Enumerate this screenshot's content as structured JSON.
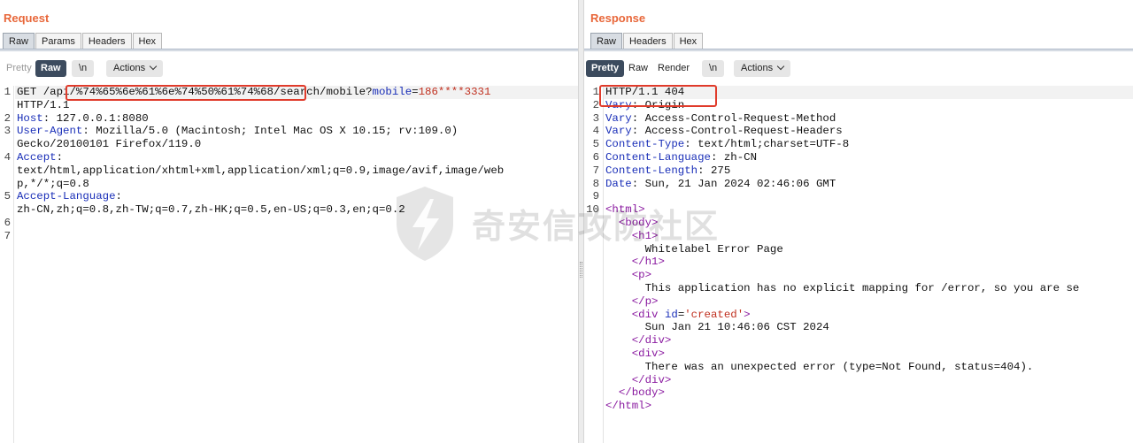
{
  "request": {
    "title": "Request",
    "tabs": [
      "Raw",
      "Params",
      "Headers",
      "Hex"
    ],
    "active_tab": "Raw",
    "toolbar": {
      "pretty": "Pretty",
      "raw": "Raw",
      "newline": "\\n",
      "actions": "Actions"
    },
    "lines": [
      {
        "n": "1",
        "parts": [
          [
            "t",
            "GET /api/%74%65%6e%61%6e%74%50%61%74%68/search/mobile?"
          ],
          [
            "k",
            "mobile"
          ],
          [
            "t",
            "="
          ],
          [
            "v",
            "186****3331"
          ]
        ]
      },
      {
        "n": "",
        "parts": [
          [
            "t",
            "HTTP/1.1"
          ]
        ]
      },
      {
        "n": "2",
        "parts": [
          [
            "k",
            "Host"
          ],
          [
            "t",
            ": 127.0.0.1:8080"
          ]
        ]
      },
      {
        "n": "3",
        "parts": [
          [
            "k",
            "User-Agent"
          ],
          [
            "t",
            ": Mozilla/5.0 (Macintosh; Intel Mac OS X 10.15; rv:109.0)"
          ]
        ]
      },
      {
        "n": "",
        "parts": [
          [
            "t",
            "Gecko/20100101 Firefox/119.0"
          ]
        ]
      },
      {
        "n": "4",
        "parts": [
          [
            "k",
            "Accept"
          ],
          [
            "t",
            ":"
          ]
        ]
      },
      {
        "n": "",
        "parts": [
          [
            "t",
            "text/html,application/xhtml+xml,application/xml;q=0.9,image/avif,image/web"
          ]
        ]
      },
      {
        "n": "",
        "parts": [
          [
            "t",
            "p,*/*;q=0.8"
          ]
        ]
      },
      {
        "n": "5",
        "parts": [
          [
            "k",
            "Accept-Language"
          ],
          [
            "t",
            ":"
          ]
        ]
      },
      {
        "n": "",
        "parts": [
          [
            "t",
            "zh-CN,zh;q=0.8,zh-TW;q=0.7,zh-HK;q=0.5,en-US;q=0.3,en;q=0.2"
          ]
        ]
      },
      {
        "n": "6",
        "parts": []
      },
      {
        "n": "7",
        "parts": []
      }
    ]
  },
  "response": {
    "title": "Response",
    "tabs": [
      "Raw",
      "Headers",
      "Hex"
    ],
    "active_tab": "Raw",
    "toolbar": {
      "pretty": "Pretty",
      "raw": "Raw",
      "render": "Render",
      "newline": "\\n",
      "actions": "Actions"
    },
    "lines": [
      {
        "n": "1",
        "parts": [
          [
            "t",
            "HTTP/1.1 404"
          ]
        ]
      },
      {
        "n": "2",
        "parts": [
          [
            "k",
            "Vary"
          ],
          [
            "t",
            ": Origin"
          ]
        ]
      },
      {
        "n": "3",
        "parts": [
          [
            "k",
            "Vary"
          ],
          [
            "t",
            ": Access-Control-Request-Method"
          ]
        ]
      },
      {
        "n": "4",
        "parts": [
          [
            "k",
            "Vary"
          ],
          [
            "t",
            ": Access-Control-Request-Headers"
          ]
        ]
      },
      {
        "n": "5",
        "parts": [
          [
            "k",
            "Content-Type"
          ],
          [
            "t",
            ": text/html;charset=UTF-8"
          ]
        ]
      },
      {
        "n": "6",
        "parts": [
          [
            "k",
            "Content-Language"
          ],
          [
            "t",
            ": zh-CN"
          ]
        ]
      },
      {
        "n": "7",
        "parts": [
          [
            "k",
            "Content-Length"
          ],
          [
            "t",
            ": 275"
          ]
        ]
      },
      {
        "n": "8",
        "parts": [
          [
            "k",
            "Date"
          ],
          [
            "t",
            ": Sun, 21 Jan 2024 02:46:06 GMT"
          ]
        ]
      },
      {
        "n": "9",
        "parts": []
      },
      {
        "n": "10",
        "parts": [
          [
            "tag",
            "<html>"
          ]
        ]
      },
      {
        "n": "",
        "parts": [
          [
            "t",
            "  "
          ],
          [
            "tag",
            "<body>"
          ]
        ]
      },
      {
        "n": "",
        "parts": [
          [
            "t",
            "    "
          ],
          [
            "tag",
            "<h1>"
          ]
        ]
      },
      {
        "n": "",
        "parts": [
          [
            "t",
            "      Whitelabel Error Page"
          ]
        ]
      },
      {
        "n": "",
        "parts": [
          [
            "t",
            "    "
          ],
          [
            "tag",
            "</h1>"
          ]
        ]
      },
      {
        "n": "",
        "parts": [
          [
            "t",
            "    "
          ],
          [
            "tag",
            "<p>"
          ]
        ]
      },
      {
        "n": "",
        "parts": [
          [
            "t",
            "      This application has no explicit mapping for /error, so you are se"
          ]
        ]
      },
      {
        "n": "",
        "parts": [
          [
            "t",
            "    "
          ],
          [
            "tag",
            "</p>"
          ]
        ]
      },
      {
        "n": "",
        "parts": [
          [
            "t",
            "    "
          ],
          [
            "tag",
            "<div "
          ],
          [
            "attr",
            "id"
          ],
          [
            "t",
            "="
          ],
          [
            "v",
            "'created'"
          ],
          [
            "tag",
            ">"
          ]
        ]
      },
      {
        "n": "",
        "parts": [
          [
            "t",
            "      Sun Jan 21 10:46:06 CST 2024"
          ]
        ]
      },
      {
        "n": "",
        "parts": [
          [
            "t",
            "    "
          ],
          [
            "tag",
            "</div>"
          ]
        ]
      },
      {
        "n": "",
        "parts": [
          [
            "t",
            "    "
          ],
          [
            "tag",
            "<div>"
          ]
        ]
      },
      {
        "n": "",
        "parts": [
          [
            "t",
            "      There was an unexpected error (type=Not Found, status=404)."
          ]
        ]
      },
      {
        "n": "",
        "parts": [
          [
            "t",
            "    "
          ],
          [
            "tag",
            "</div>"
          ]
        ]
      },
      {
        "n": "",
        "parts": [
          [
            "t",
            "  "
          ],
          [
            "tag",
            "</body>"
          ]
        ]
      },
      {
        "n": "",
        "parts": [
          [
            "tag",
            "</html>"
          ]
        ]
      }
    ]
  },
  "watermark": {
    "text": "奇安信攻防社区",
    "icon": "shield-bolt-icon"
  },
  "view_toggle": {
    "icons": [
      "split-columns-icon",
      "split-rows-icon"
    ]
  },
  "colors": {
    "accent": "#e8673a",
    "header_key": "#1a2fb8",
    "value": "#c0301f",
    "tag": "#8a1aa0",
    "highlight_box": "#e03b2b"
  }
}
